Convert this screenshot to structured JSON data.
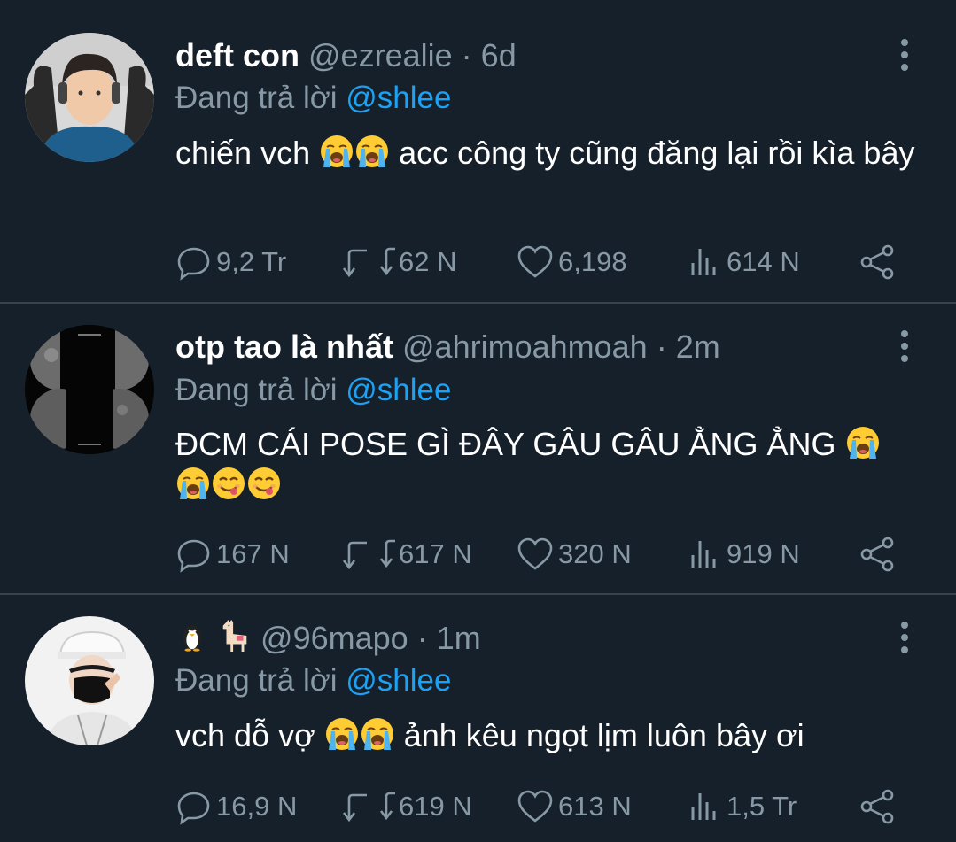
{
  "tweets": [
    {
      "display_name": "deft con",
      "name_emojis": [],
      "handle": "@ezrealie",
      "separator": "·",
      "time": "6d",
      "reply_prefix": "Đang trả lời",
      "reply_to": "@shlee",
      "text_before": "chiến vch",
      "emojis_inline": [
        "loudly-crying-face",
        "loudly-crying-face"
      ],
      "text_after": "acc công ty cũng đăng lại rồi kìa bây",
      "trailing_emojis": [],
      "stats": {
        "replies": "9,2 Tr",
        "retweets": "62 N",
        "likes": "6,198",
        "views": "614 N"
      },
      "avatar": "person-with-headphones-photo"
    },
    {
      "display_name": "otp tao là nhất",
      "name_emojis": [],
      "handle": "@ahrimoahmoah",
      "separator": "·",
      "time": "2m",
      "reply_prefix": "Đang trả lời",
      "reply_to": "@shlee",
      "text_before": "ĐCM CÁI POSE GÌ ĐÂY GÂU GÂU ẲNG ẲNG",
      "emojis_inline": [
        "loudly-crying-face"
      ],
      "text_after": "",
      "trailing_emojis": [
        "loudly-crying-face",
        "face-savoring-food",
        "face-savoring-food"
      ],
      "stats": {
        "replies": "167 N",
        "retweets": "617 N",
        "likes": "320 N",
        "views": "919 N"
      },
      "avatar": "moon-phases-image"
    },
    {
      "display_name": "",
      "name_emojis": [
        "penguin",
        "llama"
      ],
      "handle": "@96mapo",
      "separator": "·",
      "time": "1m",
      "reply_prefix": "Đang trả lời",
      "reply_to": "@shlee",
      "text_before": "vch dỗ vợ",
      "emojis_inline": [
        "loudly-crying-face",
        "loudly-crying-face"
      ],
      "text_after": "ảnh kêu ngọt lịm luôn bây ơi",
      "trailing_emojis": [],
      "stats": {
        "replies": "16,9 N",
        "retweets": "619 N",
        "likes": "613 N",
        "views": "1,5 Tr"
      },
      "avatar": "person-with-cap-and-mask-photo"
    }
  ],
  "colors": {
    "background": "#15202b",
    "divider": "#38444d",
    "text_primary": "#ffffff",
    "text_secondary": "#8899a6",
    "mention": "#1da1f2"
  }
}
